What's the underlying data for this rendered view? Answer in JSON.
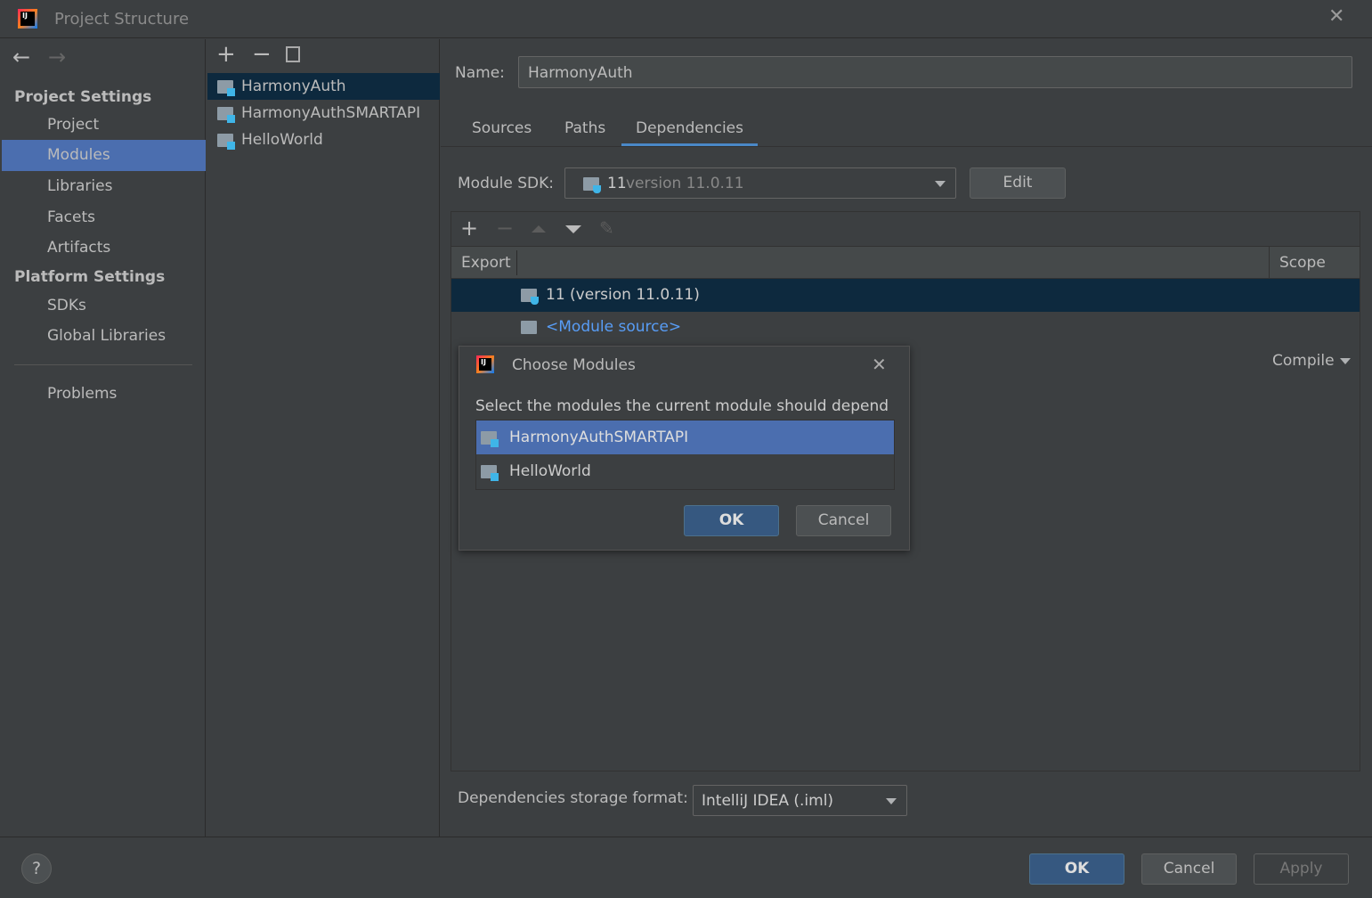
{
  "window": {
    "title": "Project Structure"
  },
  "sidebar": {
    "project_settings": "Project Settings",
    "items": [
      "Project",
      "Modules",
      "Libraries",
      "Facets",
      "Artifacts"
    ],
    "platform_settings": "Platform Settings",
    "platform_items": [
      "SDKs",
      "Global Libraries"
    ],
    "problems": "Problems",
    "selected": "Modules"
  },
  "modules": {
    "items": [
      "HarmonyAuth",
      "HarmonyAuthSMARTAPI",
      "HelloWorld"
    ],
    "selected": "HarmonyAuth"
  },
  "detail": {
    "name_label": "Name:",
    "name_value": "HarmonyAuth",
    "tabs": [
      "Sources",
      "Paths",
      "Dependencies"
    ],
    "active_tab": "Dependencies",
    "sdk_label": "Module SDK:",
    "sdk_value_main": "11",
    "sdk_value_sub": "version 11.0.11",
    "edit": "Edit",
    "table": {
      "col_export": "Export",
      "col_scope": "Scope",
      "rows": [
        {
          "name": "11 (version 11.0.11)"
        },
        {
          "name": "<Module source>"
        }
      ],
      "scope_value": "Compile"
    },
    "storage_label": "Dependencies storage format:",
    "storage_value": "IntelliJ IDEA (.iml)"
  },
  "dialog": {
    "title": "Choose Modules",
    "prompt": "Select the modules the current module should depend on:",
    "items": [
      "HarmonyAuthSMARTAPI",
      "HelloWorld"
    ],
    "selected": "HarmonyAuthSMARTAPI",
    "ok": "OK",
    "cancel": "Cancel"
  },
  "footer": {
    "help": "?",
    "ok": "OK",
    "cancel": "Cancel",
    "apply": "Apply"
  },
  "colors": {
    "selection": "#4b6eaf",
    "dark_selection": "#0d293e",
    "link": "#589df6",
    "primary_button": "#365880"
  }
}
